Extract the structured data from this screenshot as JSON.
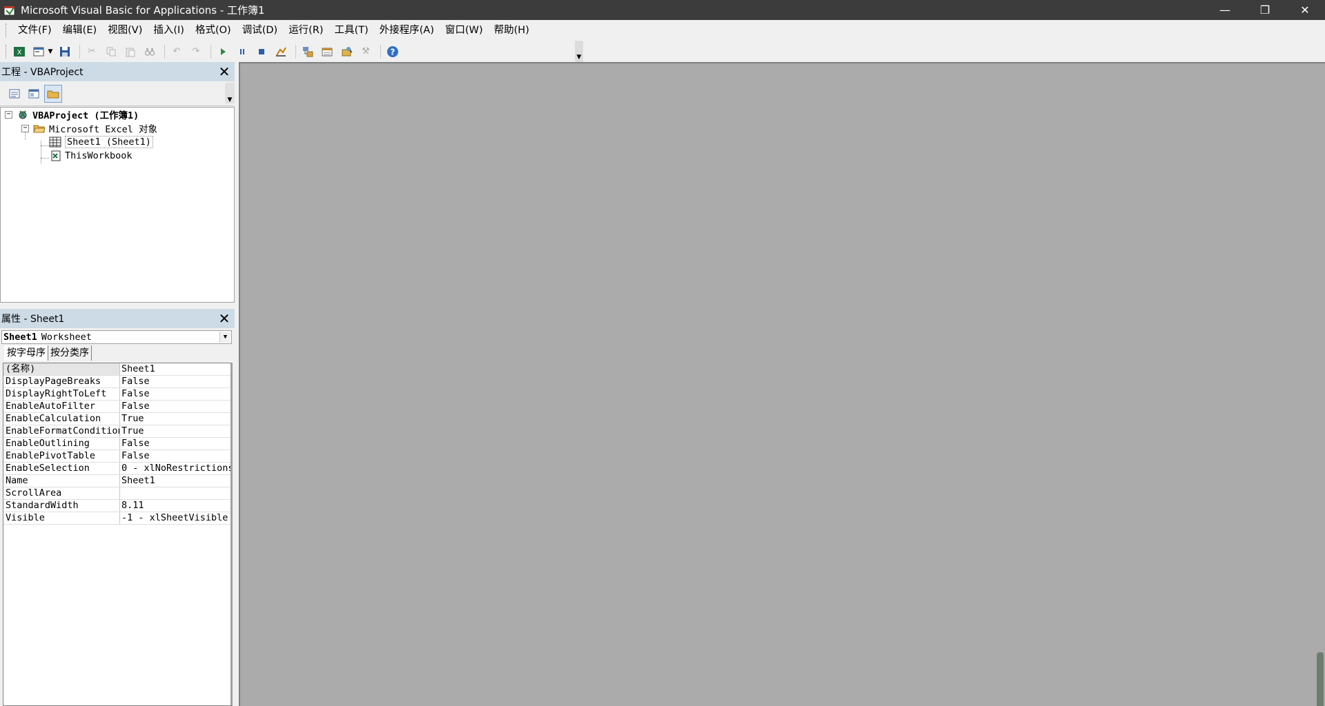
{
  "window": {
    "title": "Microsoft Visual Basic for Applications - 工作簿1",
    "minimize": "—",
    "restore": "❐",
    "close": "✕"
  },
  "menu": [
    {
      "name": "file",
      "label": "文件(F)"
    },
    {
      "name": "edit",
      "label": "编辑(E)"
    },
    {
      "name": "view",
      "label": "视图(V)"
    },
    {
      "name": "insert",
      "label": "插入(I)"
    },
    {
      "name": "format",
      "label": "格式(O)"
    },
    {
      "name": "debug",
      "label": "调试(D)"
    },
    {
      "name": "run",
      "label": "运行(R)"
    },
    {
      "name": "tools",
      "label": "工具(T)"
    },
    {
      "name": "addins",
      "label": "外接程序(A)"
    },
    {
      "name": "window",
      "label": "窗口(W)"
    },
    {
      "name": "help",
      "label": "帮助(H)"
    }
  ],
  "project_pane": {
    "title": "工程 - VBAProject",
    "close": "✕",
    "tree": {
      "root": "VBAProject (工作簿1)",
      "folder": "Microsoft Excel 对象",
      "sheet": "Sheet1 (Sheet1)",
      "workbook": "ThisWorkbook"
    }
  },
  "properties_pane": {
    "title": "属性 - Sheet1",
    "close": "✕",
    "object_name": "Sheet1",
    "object_type": "Worksheet",
    "tabs": [
      "按字母序",
      "按分类序"
    ],
    "rows": [
      {
        "name": "(名称)",
        "value": "Sheet1"
      },
      {
        "name": "DisplayPageBreaks",
        "value": "False"
      },
      {
        "name": "DisplayRightToLeft",
        "value": "False"
      },
      {
        "name": "EnableAutoFilter",
        "value": "False"
      },
      {
        "name": "EnableCalculation",
        "value": "True"
      },
      {
        "name": "EnableFormatConditionsCalculation",
        "value": "True"
      },
      {
        "name": "EnableOutlining",
        "value": "False"
      },
      {
        "name": "EnablePivotTable",
        "value": "False"
      },
      {
        "name": "EnableSelection",
        "value": "0 - xlNoRestrictions"
      },
      {
        "name": "Name",
        "value": "Sheet1"
      },
      {
        "name": "ScrollArea",
        "value": ""
      },
      {
        "name": "StandardWidth",
        "value": "8.11"
      },
      {
        "name": "Visible",
        "value": "-1 - xlSheetVisible"
      }
    ]
  },
  "colors": {
    "titlebar": "#3c3c3c",
    "pane_header": "#cddbe6",
    "mdi_background": "#ababab"
  }
}
